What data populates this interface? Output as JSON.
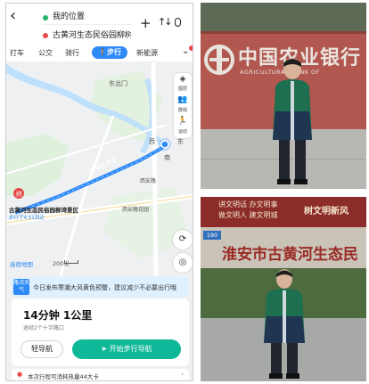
{
  "header": {
    "origin": "我的位置",
    "destination": "古黄河生态民俗园柳树...",
    "add_icon": "plus-icon",
    "swap_icon": "swap-icon",
    "voice_icon": "mic-icon"
  },
  "mode_tabs": [
    {
      "label": "打车"
    },
    {
      "label": "公交"
    },
    {
      "label": "骑行"
    },
    {
      "label": "步行",
      "active": true
    },
    {
      "label": "新能源"
    }
  ],
  "map": {
    "labels": {
      "north_gate": "东北门",
      "route_road": "健康路步道",
      "place_name": "古黄河生态民俗园柳湾景区",
      "walk_time": "步行下4.51到达",
      "west_lake_garden": "西安路花园",
      "poi_west": "西",
      "poi_east": "东",
      "poi_south": "南",
      "poi_lake": "西安路"
    },
    "side_tools": [
      "图层",
      "群组",
      "运动"
    ],
    "logo": "高德地图",
    "scale": "200米",
    "accent_route": "#2e8af6",
    "water_color": "#bfe0fb",
    "park_color": "#cfe9d0"
  },
  "weather": {
    "icon_label": "路况天气",
    "text": "今日发布寒潮大风黄色预警，建议减少不必要出行哦"
  },
  "route_card": {
    "duration": "14分钟  1公里",
    "subtitle": "途经2个十字路口",
    "light_nav_label": "轻导航",
    "start_nav_label": "开始步行导航"
  },
  "calorie": {
    "text": "本次行程可消耗热量44大卡"
  },
  "photo_top": {
    "bank_name_cn": "中国农业银行",
    "bank_name_en": "AGRICULTURAL BANK OF"
  },
  "photo_bottom": {
    "banner_line1": "讲文明话  办文明事",
    "banner_line2": "做文明人  建文明城",
    "banner_side": "树文明新风",
    "plate_number": "190",
    "sign": "淮安市古黄河生态民"
  }
}
